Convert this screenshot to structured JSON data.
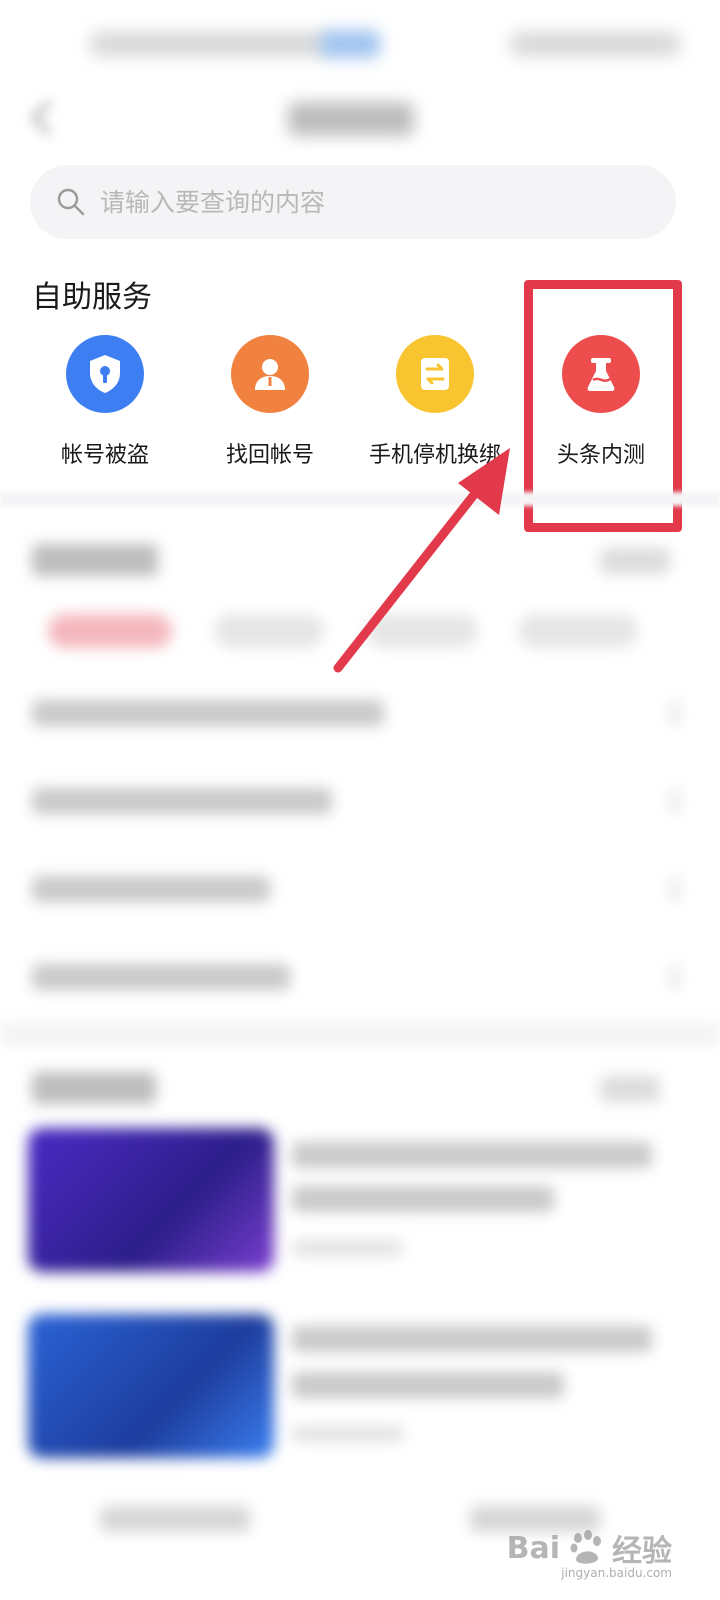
{
  "search": {
    "placeholder": "请输入要查询的内容"
  },
  "self_service": {
    "title": "自助服务",
    "items": [
      {
        "label": "帐号被盗",
        "icon": "shield-lock-icon",
        "color": "#3d7ff2"
      },
      {
        "label": "找回帐号",
        "icon": "user-icon",
        "color": "#f0813f"
      },
      {
        "label": "手机停机换绑",
        "icon": "swap-icon",
        "color": "#f8c42f"
      },
      {
        "label": "头条内测",
        "icon": "flask-icon",
        "color": "#ee4d4d"
      }
    ]
  },
  "annotation": {
    "color": "#e23a4b"
  },
  "watermark": {
    "brand": "Bai",
    "brand2": "经验",
    "domain": "jingyan.baidu.com"
  }
}
